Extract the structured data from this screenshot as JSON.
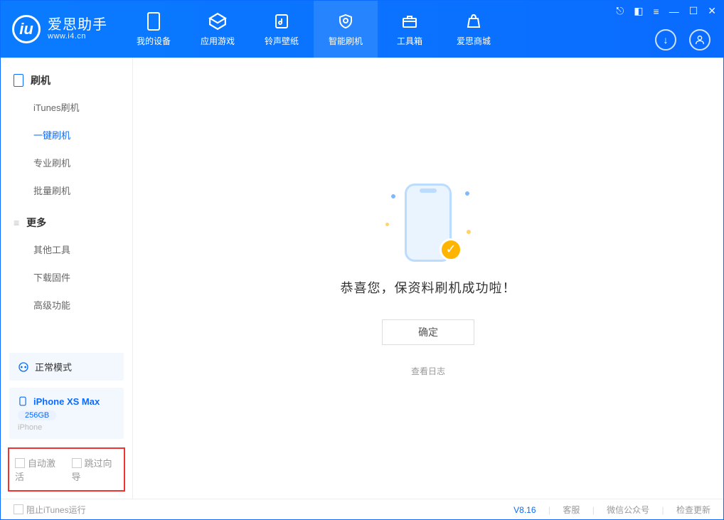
{
  "header": {
    "logo_title": "爱思助手",
    "logo_sub": "www.i4.cn",
    "tabs": [
      {
        "label": "我的设备",
        "icon": "device-icon"
      },
      {
        "label": "应用游戏",
        "icon": "cube-icon"
      },
      {
        "label": "铃声壁纸",
        "icon": "music-icon"
      },
      {
        "label": "智能刷机",
        "icon": "shield-icon",
        "active": true
      },
      {
        "label": "工具箱",
        "icon": "toolbox-icon"
      },
      {
        "label": "爱思商城",
        "icon": "store-icon"
      }
    ],
    "win_controls": [
      "shirt-icon",
      "theme-icon",
      "menu-icon",
      "minimize",
      "maximize",
      "close"
    ]
  },
  "sidebar": {
    "section1_title": "刷机",
    "section1_items": [
      "iTunes刷机",
      "一键刷机",
      "专业刷机",
      "批量刷机"
    ],
    "section1_active_index": 1,
    "section2_title": "更多",
    "section2_items": [
      "其他工具",
      "下载固件",
      "高级功能"
    ],
    "mode_label": "正常模式",
    "device_name": "iPhone XS Max",
    "device_storage": "256GB",
    "device_type": "iPhone",
    "highlight_opts": [
      "自动激活",
      "跳过向导"
    ]
  },
  "main": {
    "success_text": "恭喜您，保资料刷机成功啦！",
    "ok_button": "确定",
    "log_link": "查看日志"
  },
  "footer": {
    "left_option": "阻止iTunes运行",
    "version": "V8.16",
    "links": [
      "客服",
      "微信公众号",
      "检查更新"
    ]
  }
}
